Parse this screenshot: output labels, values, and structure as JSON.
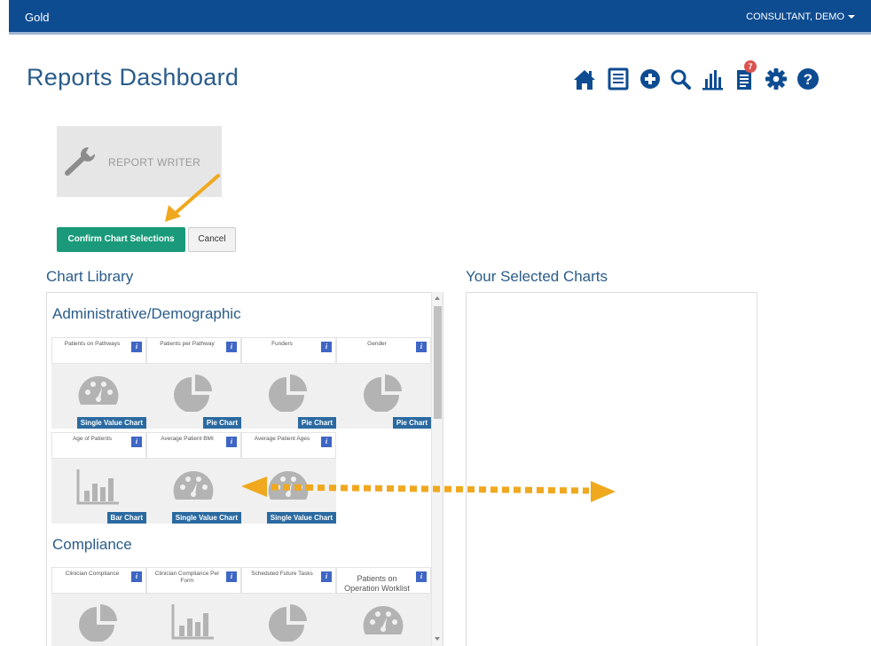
{
  "header": {
    "app_name": "Gold",
    "user_name": "CONSULTANT, DEMO"
  },
  "page_title": "Reports Dashboard",
  "toolbar": {
    "notification_count": "7"
  },
  "report_writer": {
    "label": "REPORT WRITER"
  },
  "buttons": {
    "confirm": "Confirm Chart Selections",
    "cancel": "Cancel"
  },
  "library_title": "Chart Library",
  "selected_title": "Your Selected Charts",
  "categories": [
    {
      "title": "Administrative/Demographic",
      "charts": [
        {
          "name": "Patients on Pathways",
          "type": "Single Value Chart",
          "icon": "gauge-icon"
        },
        {
          "name": "Patients per Pathway",
          "type": "Pie Chart",
          "icon": "pie-chart-icon"
        },
        {
          "name": "Funders",
          "type": "Pie Chart",
          "icon": "pie-chart-icon"
        },
        {
          "name": "Gender",
          "type": "Pie Chart",
          "icon": "pie-chart-icon"
        },
        {
          "name": "Age of Patients",
          "type": "Bar Chart",
          "icon": "bar-chart-icon"
        },
        {
          "name": "Average Patient BMI",
          "type": "Single Value Chart",
          "icon": "gauge-icon"
        },
        {
          "name": "Average Patient Ages",
          "type": "Single Value Chart",
          "icon": "gauge-icon"
        }
      ]
    },
    {
      "title": "Compliance",
      "charts": [
        {
          "name": "Clinician Compliance",
          "type": "",
          "icon": "pie-chart-icon"
        },
        {
          "name": "Clinician Compliance Per Form",
          "type": "",
          "icon": "bar-chart-icon"
        },
        {
          "name": "Scheduled Future Tasks",
          "type": "",
          "icon": "pie-chart-icon"
        },
        {
          "name": "Patients on Operation Worklist",
          "type": "",
          "icon": "gauge-icon"
        }
      ]
    }
  ],
  "colors": {
    "header_bg": "#0e4c92",
    "confirm_green": "#1a9a7a",
    "type_label_blue": "#2b6aa0",
    "info_blue": "#3f66c4",
    "annotation_orange": "#f0a81e",
    "title_blue": "#2a5c8a"
  }
}
